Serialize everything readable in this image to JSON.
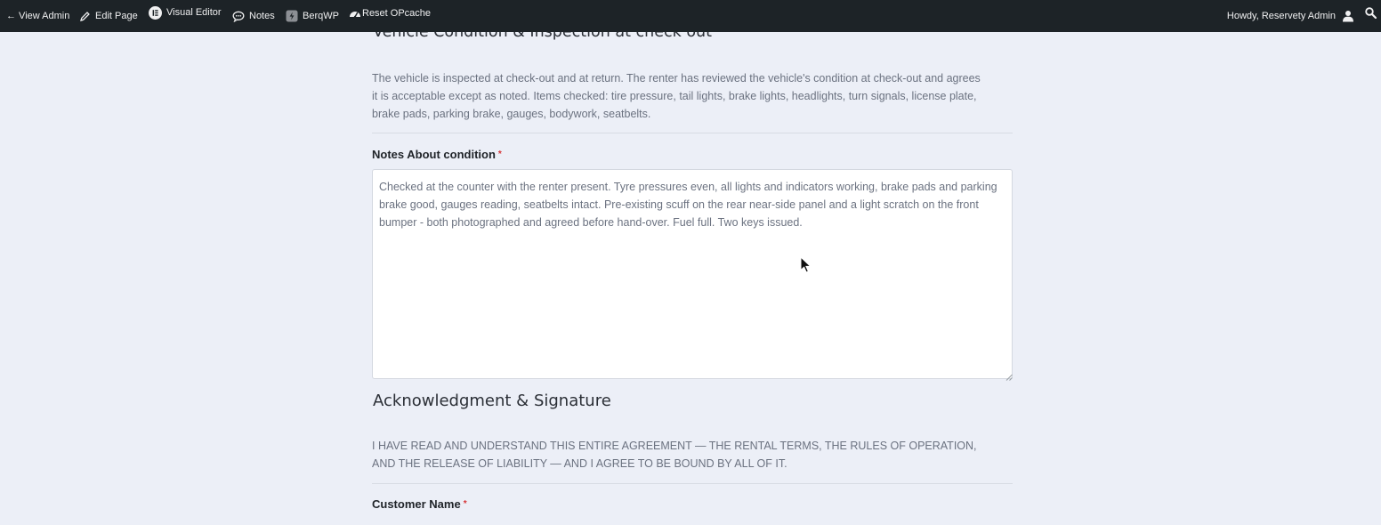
{
  "admin_bar": {
    "view_admin": "← View Admin",
    "edit_page": "Edit Page",
    "visual_editor": "Visual Editor",
    "notes": "Notes",
    "berqwp": "BerqWP",
    "reset_opcache": "Reset OPcache",
    "howdy": "Howdy, Reservety Admin",
    "icons": [
      "pencil-icon",
      "elementor-icon",
      "comment-icon",
      "berqwp-icon",
      "dashboard-icon",
      "user-icon",
      "search-icon"
    ]
  },
  "vehicle_section": {
    "heading": "Vehicle Condition & Inspection at check out",
    "description": "The vehicle is inspected at check-out and at return. The renter has reviewed the vehicle's condition at check-out and agrees it is acceptable except as noted. Items checked: tire pressure, tail lights, brake lights, headlights, turn signals, license plate, brake pads, parking brake, gauges, bodywork, seatbelts."
  },
  "notes_field": {
    "label": "Notes About condition",
    "required_mark": "*",
    "value": "Checked at the counter with the renter present. Tyre pressures even, all lights and indicators working, brake pads and parking brake good, gauges reading, seatbelts intact. Pre-existing scuff on the rear near-side panel and a light scratch on the front bumper - both photographed and agreed before hand-over. Fuel full. Two keys issued."
  },
  "ack_section": {
    "heading": "Acknowledgment & Signature",
    "description": "I HAVE READ AND UNDERSTAND THIS ENTIRE AGREEMENT — THE RENTAL TERMS, THE RULES OF OPERATION, AND THE RELEASE OF LIABILITY — AND I AGREE TO BE BOUND BY ALL OF IT."
  },
  "customer_name_field": {
    "label": "Customer Name",
    "required_mark": "*"
  }
}
